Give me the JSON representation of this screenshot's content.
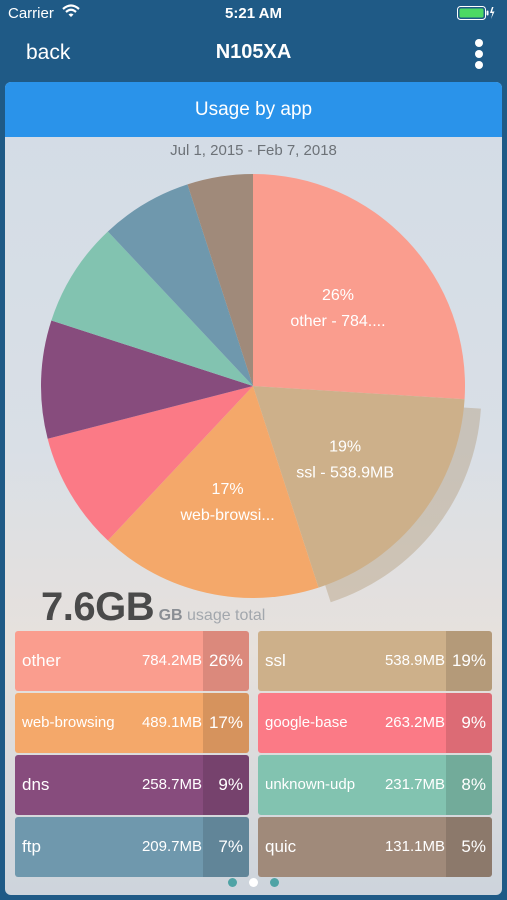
{
  "status": {
    "carrier": "Carrier",
    "time": "5:21 AM"
  },
  "nav": {
    "back": "back",
    "title": "N105XA"
  },
  "card": {
    "header": "Usage by app",
    "date_range": "Jul 1, 2015 - Feb 7, 2018"
  },
  "total": {
    "value": "7.6GB",
    "unit": "GB",
    "caption": "usage total"
  },
  "colors": {
    "other": "#fa9d8e",
    "ssl": "#cdb08a",
    "web-browsing": "#f4a86a",
    "google-base": "#fb7a86",
    "dns": "#874c7d",
    "unknown-udp": "#82c3b0",
    "ftp": "#6f98ad",
    "quic": "#a08a7a"
  },
  "chart_data": {
    "type": "pie",
    "slices": [
      {
        "label": "other",
        "size": "784.2MB",
        "value": 26,
        "pct": "26%",
        "pie_text": "other - 784...."
      },
      {
        "label": "ssl",
        "size": "538.9MB",
        "value": 19,
        "pct": "19%",
        "pie_text": "ssl - 538.9MB"
      },
      {
        "label": "web-browsing",
        "size": "489.1MB",
        "value": 17,
        "pct": "17%",
        "pie_text": "web-browsi..."
      },
      {
        "label": "google-base",
        "size": "263.2MB",
        "value": 9,
        "pct": "9%",
        "pie_text": ""
      },
      {
        "label": "dns",
        "size": "258.7MB",
        "value": 9,
        "pct": "9%",
        "pie_text": ""
      },
      {
        "label": "unknown-udp",
        "size": "231.7MB",
        "value": 8,
        "pct": "8%",
        "pie_text": ""
      },
      {
        "label": "ftp",
        "size": "209.7MB",
        "value": 7,
        "pct": "7%",
        "pie_text": ""
      },
      {
        "label": "quic",
        "size": "131.1MB",
        "value": 5,
        "pct": "5%",
        "pie_text": ""
      }
    ],
    "highlighted": "ssl"
  },
  "tiles": [
    {
      "name": "other",
      "size": "784.2MB",
      "pct": "26%"
    },
    {
      "name": "ssl",
      "size": "538.9MB",
      "pct": "19%"
    },
    {
      "name": "web-browsing",
      "size": "489.1MB",
      "pct": "17%"
    },
    {
      "name": "google-base",
      "size": "263.2MB",
      "pct": "9%"
    },
    {
      "name": "dns",
      "size": "258.7MB",
      "pct": "9%"
    },
    {
      "name": "unknown-udp",
      "size": "231.7MB",
      "pct": "8%"
    },
    {
      "name": "ftp",
      "size": "209.7MB",
      "pct": "7%"
    },
    {
      "name": "quic",
      "size": "131.1MB",
      "pct": "5%"
    }
  ]
}
